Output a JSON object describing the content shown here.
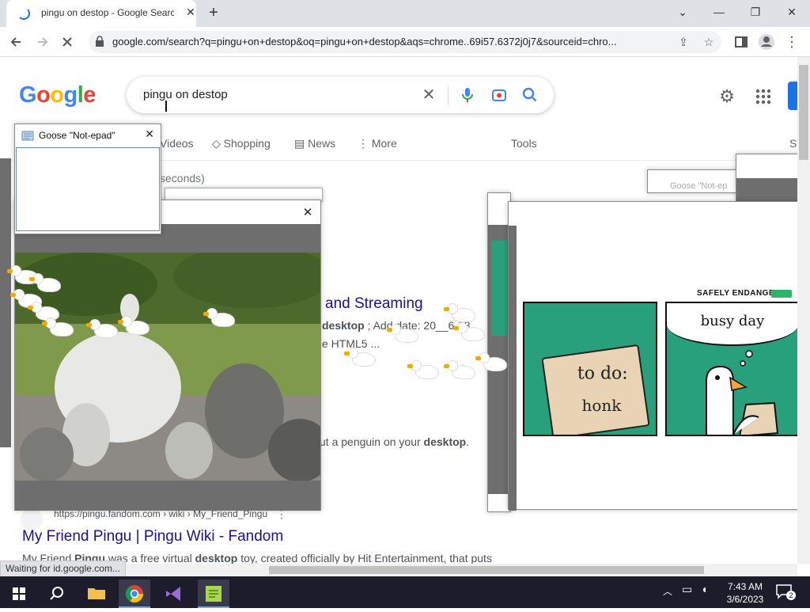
{
  "browser": {
    "tab_title": "pingu on destop - Google Search",
    "tab_close_glyph": "✕",
    "new_tab_glyph": "+",
    "url": "google.com/search?q=pingu+on+destop&oq=pingu+on+destop&aqs=chrome..69i57.6372j0j7&sourceid=chro...",
    "status_text": "Waiting for id.google.com...",
    "window_buttons": [
      "⌄",
      "—",
      "❐",
      "✕"
    ]
  },
  "google": {
    "logo_letters": [
      "G",
      "o",
      "o",
      "g",
      "l",
      "e"
    ],
    "logo_colors": [
      "#4285F4",
      "#EA4335",
      "#FBBC05",
      "#4285F4",
      "#34A853",
      "#EA4335"
    ],
    "query": "pingu on destop",
    "tabs": {
      "videos": "Videos",
      "shopping": "Shopping",
      "news": "News",
      "more": "More",
      "tools": "Tools",
      "partial": "S"
    },
    "stats": "seconds)",
    "result1_title_partial": "and Streaming",
    "result1_snip_line1": {
      "bold": "desktop",
      "rest": " ; Add date: 20__6-28"
    },
    "result1_snip_line2": "e HTML5 ...",
    "result2_snip": {
      "pre": "ut a penguin on your ",
      "bold": "desktop",
      "post": "."
    },
    "result3_url": "https://pingu.fandom.com › wiki › My_Friend_Pingu",
    "result3_title": "My Friend Pingu | Pingu Wiki - Fandom",
    "result3_snip": {
      "pre": "My Friend ",
      "b1": "Pingu",
      "mid": " was a free virtual ",
      "b2": "desktop",
      "post": " toy, created officially by Hit Entertainment, that puts"
    }
  },
  "goose_notepad": {
    "title": "Goose \"Not-epad\"",
    "close_glyph": "✕"
  },
  "goose_notepad_ghost": {
    "title": "Goose \"Not-ep"
  },
  "meme_window": {
    "close_glyph": "✕"
  },
  "comic_window": {
    "close_glyph": "✕",
    "header": "SAFELY ENDANGERED",
    "panel1_line1": "to do:",
    "panel1_line2": "honk",
    "panel2_caption": "busy day"
  },
  "taskbar": {
    "time": "7:43 AM",
    "date": "3/6/2023",
    "notification_count": "2"
  },
  "colors": {
    "accent": "#1a73e8",
    "comic_green": "#28a07c",
    "taskbar": "#1c1c2a"
  }
}
